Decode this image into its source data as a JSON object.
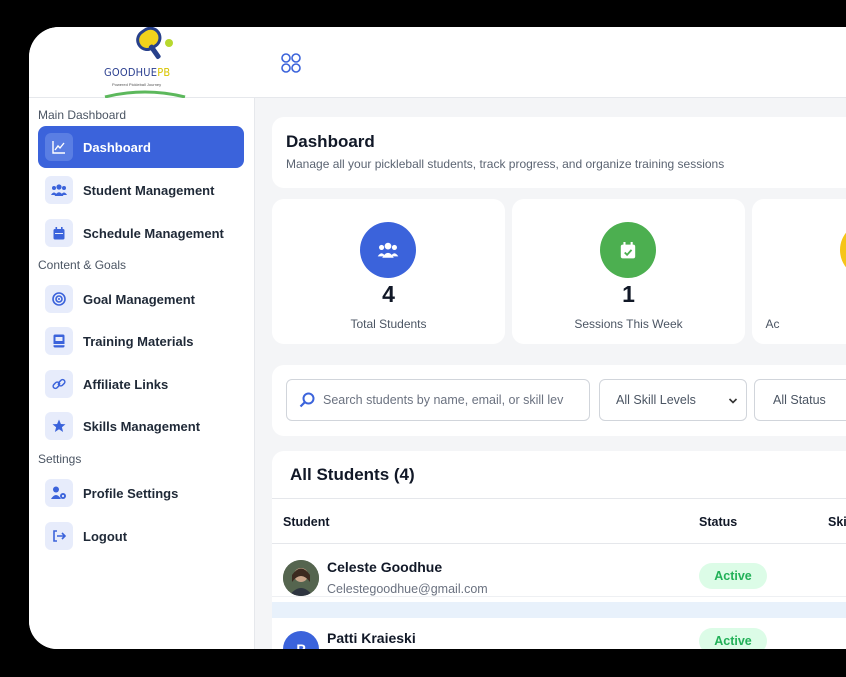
{
  "brand": {
    "name_primary": "GOODHUE",
    "name_accent": "PB",
    "tagline": "Powered Pickleball Journey",
    "accent_color": "#3b63db"
  },
  "sidebar": {
    "sections": [
      {
        "label": "Main Dashboard",
        "items": [
          {
            "label": "Dashboard",
            "icon": "chart-line-icon",
            "active": true
          },
          {
            "label": "Student Management",
            "icon": "users-icon",
            "active": false
          },
          {
            "label": "Schedule Management",
            "icon": "calendar-icon",
            "active": false
          }
        ]
      },
      {
        "label": "Content & Goals",
        "items": [
          {
            "label": "Goal Management",
            "icon": "target-icon",
            "active": false
          },
          {
            "label": "Training Materials",
            "icon": "book-icon",
            "active": false
          },
          {
            "label": "Affiliate Links",
            "icon": "link-icon",
            "active": false
          },
          {
            "label": "Skills Management",
            "icon": "star-icon",
            "active": false
          }
        ]
      },
      {
        "label": "Settings",
        "items": [
          {
            "label": "Profile Settings",
            "icon": "user-cog-icon",
            "active": false
          },
          {
            "label": "Logout",
            "icon": "logout-icon",
            "active": false
          }
        ]
      }
    ]
  },
  "header": {
    "title": "Dashboard",
    "subtitle": "Manage all your pickleball students, track progress, and organize training sessions"
  },
  "stats": [
    {
      "value": "4",
      "label": "Total Students",
      "icon": "users-icon",
      "color": "#3b63db"
    },
    {
      "value": "1",
      "label": "Sessions This Week",
      "icon": "calendar-check-icon",
      "color": "#4caf50"
    },
    {
      "value": "",
      "label": "Ac",
      "icon": "",
      "color": "#f5c518"
    }
  ],
  "filters": {
    "search_placeholder": "Search students by name, email, or skill lev",
    "skill_select": "All Skill Levels",
    "status_select": "All Status"
  },
  "table": {
    "title": "All Students (4)",
    "columns": [
      "Student",
      "Status",
      "Ski"
    ],
    "rows": [
      {
        "name": "Celeste Goodhue",
        "email": "Celestegoodhue@gmail.com",
        "status": "Active",
        "initial": ""
      },
      {
        "name": "Patti Kraieski",
        "email": "",
        "status": "Active",
        "initial": "P"
      }
    ]
  }
}
